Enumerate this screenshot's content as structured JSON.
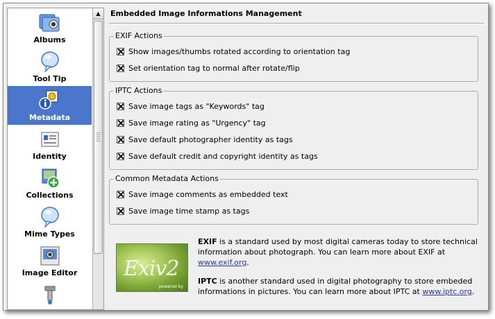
{
  "sidebar": {
    "items": [
      {
        "label": "Albums",
        "icon": "albums-icon"
      },
      {
        "label": "Tool Tip",
        "icon": "tooltip-icon"
      },
      {
        "label": "Metadata",
        "icon": "metadata-icon",
        "selected": true
      },
      {
        "label": "Identity",
        "icon": "identity-icon"
      },
      {
        "label": "Collections",
        "icon": "collections-icon"
      },
      {
        "label": "Mime Types",
        "icon": "mime-types-icon"
      },
      {
        "label": "Image Editor",
        "icon": "image-editor-icon"
      },
      {
        "label": "",
        "icon": "plugins-icon"
      }
    ]
  },
  "main": {
    "title": "Embedded Image Informations Management",
    "exif": {
      "title": "EXIF Actions",
      "options": [
        {
          "label": "Show images/thumbs rotated according to orientation tag",
          "checked": true
        },
        {
          "label": "Set orientation tag to normal after rotate/flip",
          "checked": true
        }
      ]
    },
    "iptc": {
      "title": "IPTC Actions",
      "options": [
        {
          "label": "Save image tags as \"Keywords\" tag",
          "checked": true
        },
        {
          "label": "Save image rating as \"Urgency\" tag",
          "checked": true
        },
        {
          "label": "Save default photographer identity as tags",
          "checked": true
        },
        {
          "label": "Save default credit and copyright identity as tags",
          "checked": true
        }
      ]
    },
    "common": {
      "title": "Common Metadata Actions",
      "options": [
        {
          "label": "Save image comments as embedded text",
          "checked": true
        },
        {
          "label": "Save image time stamp as tags",
          "checked": true
        }
      ]
    },
    "info": {
      "logo_text": "Exiv2",
      "logo_sub": "powered by",
      "exif_term": "EXIF",
      "exif_text": " is a standard used by most digital cameras today to store technical information about photograph. You can learn more about EXIF at ",
      "exif_link": "www.exif.org",
      "iptc_term": "IPTC",
      "iptc_text": " is another standard used in digital photography to store embeded informations in pictures. You can learn more about IPTC at ",
      "iptc_link": "www.iptc.org",
      "end": "."
    }
  },
  "colors": {
    "selection": "#4a76cc",
    "window_bg": "#efefef",
    "link": "#2a3a9a"
  }
}
